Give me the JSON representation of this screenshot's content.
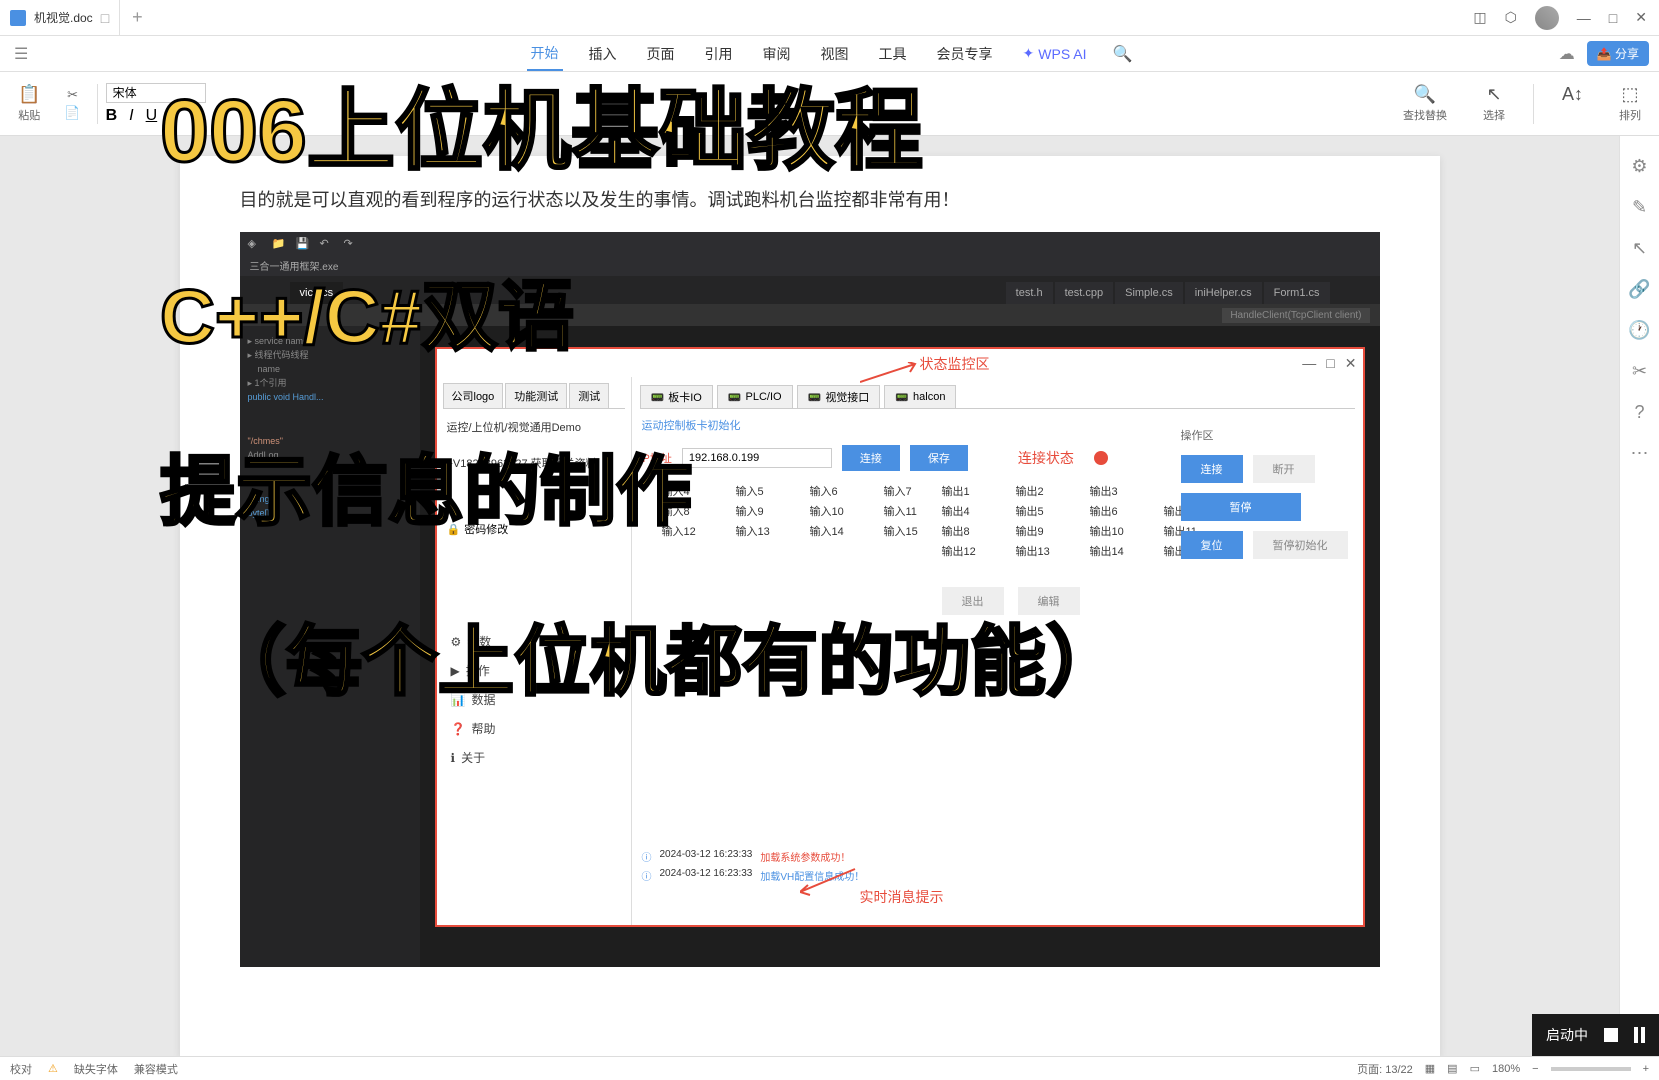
{
  "titlebar": {
    "tab_name": "机视觉.doc",
    "window_controls": [
      "◫",
      "⬡",
      "—",
      "□",
      "✕"
    ]
  },
  "menubar": {
    "items": [
      "开始",
      "插入",
      "页面",
      "引用",
      "审阅",
      "视图",
      "工具",
      "会员专享"
    ],
    "wps_ai": "WPS AI",
    "share": "分享"
  },
  "toolbar": {
    "paste": "粘贴",
    "font": "宋体",
    "find_replace": "查找替换",
    "select": "选择",
    "arrange": "排列"
  },
  "document": {
    "paragraph": "目的就是可以直观的看到程序的运行状态以及发生的事情。调试跑料机台监控都非常有用！"
  },
  "screenshot": {
    "vs_filename": "三合一通用框架.exe",
    "vs_tabs": [
      "vice.cs",
      "test.h",
      "test.cpp",
      "Simple.cs",
      "iniHelper.cs",
      "Form1.cs"
    ],
    "vs_breadcrumb": "HandleClient(TcpClient client)",
    "dialog": {
      "left_tabs": [
        "公司logo",
        "功能测试",
        "测试"
      ],
      "demo_title": "运控/上位机/视觉通用Demo",
      "contact": "+V18218963927 获取相关资料",
      "password": "密码修改",
      "menu": [
        "参数",
        "操作",
        "数据",
        "帮助",
        "关于"
      ],
      "main_tabs": [
        "板卡IO",
        "PLC/IO",
        "视觉接口",
        "halcon"
      ],
      "subtitle": "运动控制板卡初始化",
      "ip_label": "IP地址",
      "ip_value": "192.168.0.199",
      "conn_btn": "连接",
      "save_btn": "保存",
      "status_label": "连接状态",
      "inputs": [
        "输入4",
        "输入5",
        "输入6",
        "输入7",
        "输入8",
        "输入9",
        "输入10",
        "输入11",
        "输入12",
        "输入13",
        "输入14",
        "输入15"
      ],
      "outputs": [
        "输出1",
        "输出2",
        "输出3",
        "",
        "输出4",
        "输出5",
        "输出6",
        "输出7",
        "输出8",
        "输出9",
        "输出10",
        "输出11",
        "输出12",
        "输出13",
        "输出14",
        "输出15"
      ],
      "ops_title": "操作区",
      "ops_buttons": [
        "连接",
        "断开",
        "暂停",
        "复位",
        "暂停初始化"
      ],
      "bottom": [
        "退出",
        "编辑"
      ],
      "log1_time": "2024-03-12 16:23:33",
      "log1_text": "加载系统参数成功！",
      "log2_time": "2024-03-12 16:23:33",
      "log2_text": "加载VH配置信息成功！"
    },
    "callout_status": "状态监控区",
    "callout_log": "实时消息提示"
  },
  "overlay": {
    "line1": "006上位机基础教程",
    "line2": "C++/C#双语",
    "line3": "提示信息的制作",
    "line4": "（每个上位机都有的功能）"
  },
  "video": {
    "status": "启动中"
  },
  "statusbar": {
    "proof": "校对",
    "missing_font": "缺失字体",
    "compat": "兼容模式",
    "page": "页面: 13/22",
    "zoom": "180%"
  }
}
